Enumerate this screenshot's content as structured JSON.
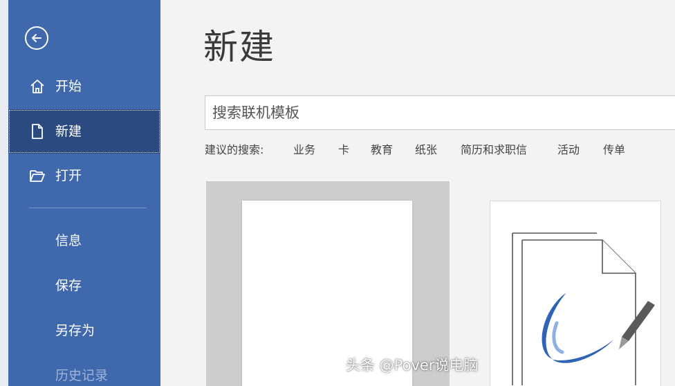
{
  "sidebar": {
    "back_icon": "arrow-left-circle-icon",
    "items": [
      {
        "label": "开始",
        "icon": "home-icon"
      },
      {
        "label": "新建",
        "icon": "new-document-icon"
      },
      {
        "label": "打开",
        "icon": "open-folder-icon"
      }
    ],
    "sub_items": [
      {
        "label": "信息"
      },
      {
        "label": "保存"
      },
      {
        "label": "另存为"
      },
      {
        "label": "历史记录"
      }
    ]
  },
  "main": {
    "title": "新建",
    "search": {
      "placeholder": "搜索联机模板"
    },
    "suggestions": {
      "label": "建议的搜索:",
      "links": [
        "业务",
        "卡",
        "教育",
        "纸张",
        "简历和求职信",
        "活动",
        "传单"
      ]
    }
  },
  "watermark": "头条 @Pover说电脑",
  "colors": {
    "sidebar_bg": "#3f68ad",
    "sidebar_active": "#2b4a80",
    "main_bg": "#f3f3f3",
    "accent_swirl": "#2f63b6"
  }
}
